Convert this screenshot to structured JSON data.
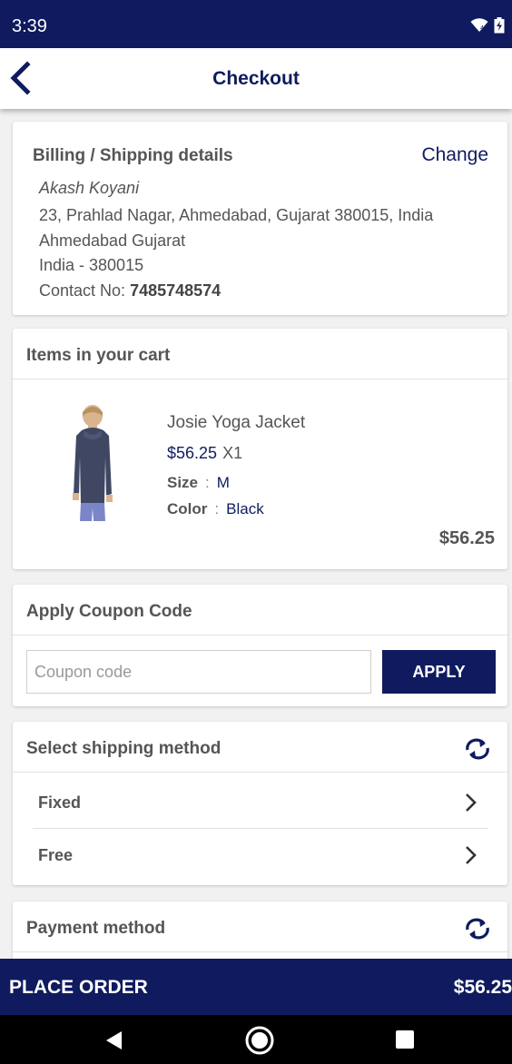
{
  "status_bar": {
    "time": "3:39",
    "icons": [
      "wifi-icon",
      "battery-charging-icon"
    ]
  },
  "app_bar": {
    "title": "Checkout",
    "back_icon": "chevron-left-icon"
  },
  "billing": {
    "title": "Billing / Shipping details",
    "change_label": "Change",
    "name": "Akash Koyani",
    "address_line1": "23, Prahlad Nagar, Ahmedabad, Gujarat 380015, India",
    "address_line2": "Ahmedabad Gujarat",
    "address_line3": "India - 380015",
    "contact_label": "Contact No:",
    "contact_number": "7485748574"
  },
  "cart": {
    "title": "Items in your cart",
    "items": [
      {
        "name": "Josie Yoga Jacket",
        "price": "$56.25",
        "quantity": "X1",
        "size_label": "Size",
        "size_value": "M",
        "color_label": "Color",
        "color_value": "Black",
        "total": "$56.25"
      }
    ]
  },
  "coupon": {
    "title": "Apply Coupon Code",
    "placeholder": "Coupon code",
    "value": "",
    "apply_label": "APPLY"
  },
  "shipping": {
    "title": "Select shipping method",
    "refresh_icon": "refresh-icon",
    "methods": [
      {
        "label": "Fixed"
      },
      {
        "label": "Free"
      }
    ]
  },
  "payment": {
    "title": "Payment method",
    "refresh_icon": "refresh-icon"
  },
  "place_order": {
    "label": "PLACE ORDER",
    "total": "$56.25"
  },
  "nav_bar": {
    "buttons": [
      "back-triangle-icon",
      "home-circle-icon",
      "recents-square-icon"
    ]
  },
  "colors": {
    "primary": "#0f1b5e",
    "background": "#f1f1f1",
    "text": "#555555"
  }
}
